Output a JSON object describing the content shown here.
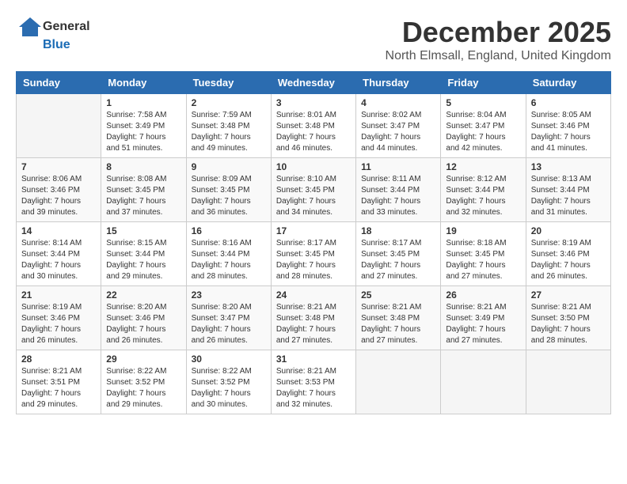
{
  "header": {
    "logo_general": "General",
    "logo_blue": "Blue",
    "title": "December 2025",
    "subtitle": "North Elmsall, England, United Kingdom"
  },
  "columns": [
    "Sunday",
    "Monday",
    "Tuesday",
    "Wednesday",
    "Thursday",
    "Friday",
    "Saturday"
  ],
  "weeks": [
    [
      {
        "day": "",
        "info": ""
      },
      {
        "day": "1",
        "info": "Sunrise: 7:58 AM\nSunset: 3:49 PM\nDaylight: 7 hours\nand 51 minutes."
      },
      {
        "day": "2",
        "info": "Sunrise: 7:59 AM\nSunset: 3:48 PM\nDaylight: 7 hours\nand 49 minutes."
      },
      {
        "day": "3",
        "info": "Sunrise: 8:01 AM\nSunset: 3:48 PM\nDaylight: 7 hours\nand 46 minutes."
      },
      {
        "day": "4",
        "info": "Sunrise: 8:02 AM\nSunset: 3:47 PM\nDaylight: 7 hours\nand 44 minutes."
      },
      {
        "day": "5",
        "info": "Sunrise: 8:04 AM\nSunset: 3:47 PM\nDaylight: 7 hours\nand 42 minutes."
      },
      {
        "day": "6",
        "info": "Sunrise: 8:05 AM\nSunset: 3:46 PM\nDaylight: 7 hours\nand 41 minutes."
      }
    ],
    [
      {
        "day": "7",
        "info": "Sunrise: 8:06 AM\nSunset: 3:46 PM\nDaylight: 7 hours\nand 39 minutes."
      },
      {
        "day": "8",
        "info": "Sunrise: 8:08 AM\nSunset: 3:45 PM\nDaylight: 7 hours\nand 37 minutes."
      },
      {
        "day": "9",
        "info": "Sunrise: 8:09 AM\nSunset: 3:45 PM\nDaylight: 7 hours\nand 36 minutes."
      },
      {
        "day": "10",
        "info": "Sunrise: 8:10 AM\nSunset: 3:45 PM\nDaylight: 7 hours\nand 34 minutes."
      },
      {
        "day": "11",
        "info": "Sunrise: 8:11 AM\nSunset: 3:44 PM\nDaylight: 7 hours\nand 33 minutes."
      },
      {
        "day": "12",
        "info": "Sunrise: 8:12 AM\nSunset: 3:44 PM\nDaylight: 7 hours\nand 32 minutes."
      },
      {
        "day": "13",
        "info": "Sunrise: 8:13 AM\nSunset: 3:44 PM\nDaylight: 7 hours\nand 31 minutes."
      }
    ],
    [
      {
        "day": "14",
        "info": "Sunrise: 8:14 AM\nSunset: 3:44 PM\nDaylight: 7 hours\nand 30 minutes."
      },
      {
        "day": "15",
        "info": "Sunrise: 8:15 AM\nSunset: 3:44 PM\nDaylight: 7 hours\nand 29 minutes."
      },
      {
        "day": "16",
        "info": "Sunrise: 8:16 AM\nSunset: 3:44 PM\nDaylight: 7 hours\nand 28 minutes."
      },
      {
        "day": "17",
        "info": "Sunrise: 8:17 AM\nSunset: 3:45 PM\nDaylight: 7 hours\nand 28 minutes."
      },
      {
        "day": "18",
        "info": "Sunrise: 8:17 AM\nSunset: 3:45 PM\nDaylight: 7 hours\nand 27 minutes."
      },
      {
        "day": "19",
        "info": "Sunrise: 8:18 AM\nSunset: 3:45 PM\nDaylight: 7 hours\nand 27 minutes."
      },
      {
        "day": "20",
        "info": "Sunrise: 8:19 AM\nSunset: 3:46 PM\nDaylight: 7 hours\nand 26 minutes."
      }
    ],
    [
      {
        "day": "21",
        "info": "Sunrise: 8:19 AM\nSunset: 3:46 PM\nDaylight: 7 hours\nand 26 minutes."
      },
      {
        "day": "22",
        "info": "Sunrise: 8:20 AM\nSunset: 3:46 PM\nDaylight: 7 hours\nand 26 minutes."
      },
      {
        "day": "23",
        "info": "Sunrise: 8:20 AM\nSunset: 3:47 PM\nDaylight: 7 hours\nand 26 minutes."
      },
      {
        "day": "24",
        "info": "Sunrise: 8:21 AM\nSunset: 3:48 PM\nDaylight: 7 hours\nand 27 minutes."
      },
      {
        "day": "25",
        "info": "Sunrise: 8:21 AM\nSunset: 3:48 PM\nDaylight: 7 hours\nand 27 minutes."
      },
      {
        "day": "26",
        "info": "Sunrise: 8:21 AM\nSunset: 3:49 PM\nDaylight: 7 hours\nand 27 minutes."
      },
      {
        "day": "27",
        "info": "Sunrise: 8:21 AM\nSunset: 3:50 PM\nDaylight: 7 hours\nand 28 minutes."
      }
    ],
    [
      {
        "day": "28",
        "info": "Sunrise: 8:21 AM\nSunset: 3:51 PM\nDaylight: 7 hours\nand 29 minutes."
      },
      {
        "day": "29",
        "info": "Sunrise: 8:22 AM\nSunset: 3:52 PM\nDaylight: 7 hours\nand 29 minutes."
      },
      {
        "day": "30",
        "info": "Sunrise: 8:22 AM\nSunset: 3:52 PM\nDaylight: 7 hours\nand 30 minutes."
      },
      {
        "day": "31",
        "info": "Sunrise: 8:21 AM\nSunset: 3:53 PM\nDaylight: 7 hours\nand 32 minutes."
      },
      {
        "day": "",
        "info": ""
      },
      {
        "day": "",
        "info": ""
      },
      {
        "day": "",
        "info": ""
      }
    ]
  ]
}
